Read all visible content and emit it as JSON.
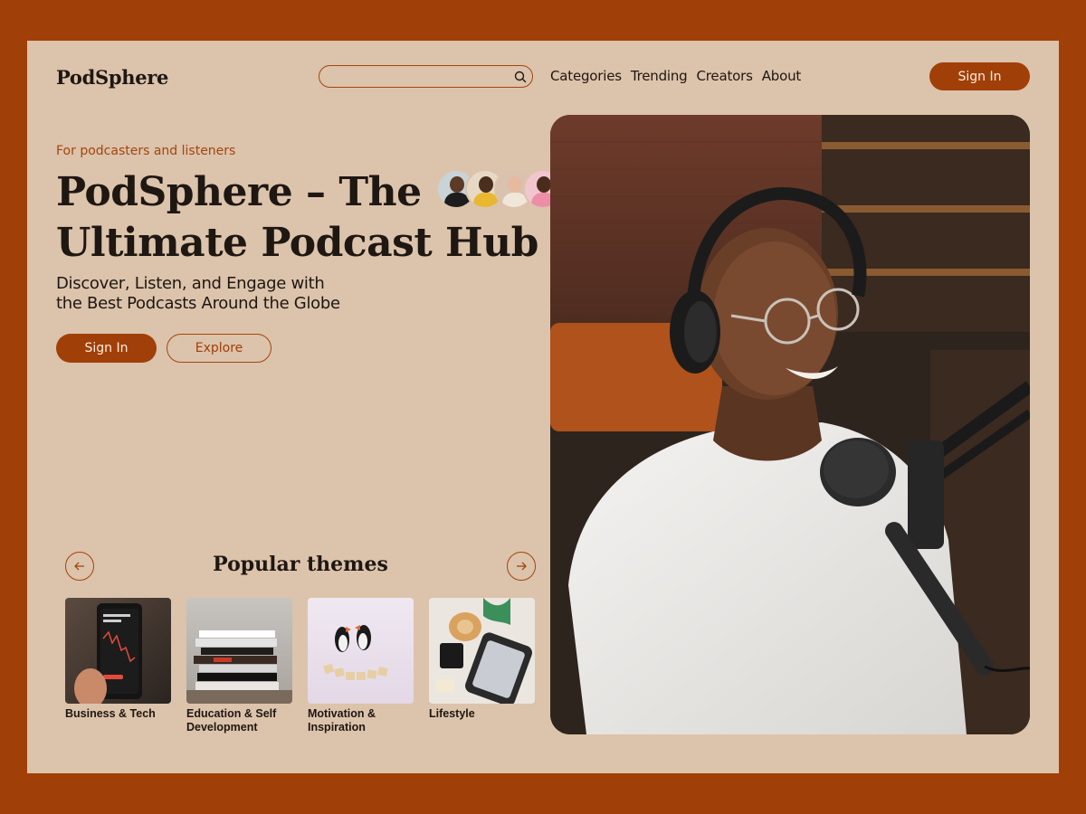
{
  "header": {
    "logo": "PodSphere",
    "search_placeholder": "",
    "nav": [
      "Categories",
      "Trending",
      "Creators",
      "About"
    ],
    "sign_in": "Sign In"
  },
  "hero": {
    "eyebrow": "For podcasters and listeners",
    "title_line1": "PodSphere – The",
    "title_line2": "Ultimate Podcast Hub",
    "subtitle_line1": "Discover, Listen, and Engage with",
    "subtitle_line2": "the Best Podcasts Around the Globe",
    "primary_button": "Sign In",
    "secondary_button": "Explore"
  },
  "themes": {
    "title": "Popular themes",
    "items": [
      {
        "label": "Business & Tech",
        "icon": "stock-chart-phone"
      },
      {
        "label": "Education & Self Development",
        "icon": "book-stack"
      },
      {
        "label": "Motivation & Inspiration",
        "icon": "puffin-figurines"
      },
      {
        "label": "Lifestyle",
        "icon": "travel-suitcase"
      }
    ]
  },
  "colors": {
    "frame": "#a13f08",
    "page": "#dcc3ab",
    "accent": "#a13f08",
    "text": "#1e1712"
  }
}
